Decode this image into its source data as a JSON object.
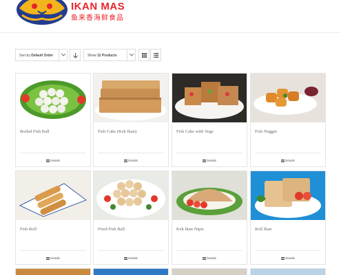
{
  "brand": {
    "name": "IKAN MAS",
    "chinese_name": "鱼来香海鲜食品",
    "colors": {
      "brand_red": "#e8232a",
      "logo_blue": "#243c8f",
      "logo_gold": "#f2b51c"
    }
  },
  "toolbar": {
    "sort_label": "Sort by",
    "sort_value": "Default Order",
    "show_label": "Show",
    "show_value": "12 Products",
    "sort_direction_icon": "arrow-down-icon",
    "grid_view_icon": "grid-icon",
    "list_view_icon": "list-icon"
  },
  "products": [
    {
      "name": "Boiled Fish Ball",
      "details_label": "Details",
      "photo": "fish-balls-on-lettuce"
    },
    {
      "name": "Fish Cake (Kek Ikan)",
      "details_label": "Details",
      "photo": "sliced-fish-cake"
    },
    {
      "name": "Fish Cake with Vege",
      "details_label": "Details",
      "photo": "fish-cake-with-vegetables"
    },
    {
      "name": "Fish Nugget",
      "details_label": "Details",
      "photo": "fried-fish-nuggets-with-sauce"
    },
    {
      "name": "Fish Roll",
      "details_label": "Details",
      "photo": "fried-fish-rolls"
    },
    {
      "name": "Fried Fish Ball",
      "details_label": "Details",
      "photo": "fried-fish-balls"
    },
    {
      "name": "Kek Ikan Nipis",
      "details_label": "Details",
      "photo": "thin-fish-cake-with-tomato"
    },
    {
      "name": "Roll Ikan",
      "details_label": "Details",
      "photo": "fish-roll-slices-on-blue"
    }
  ]
}
